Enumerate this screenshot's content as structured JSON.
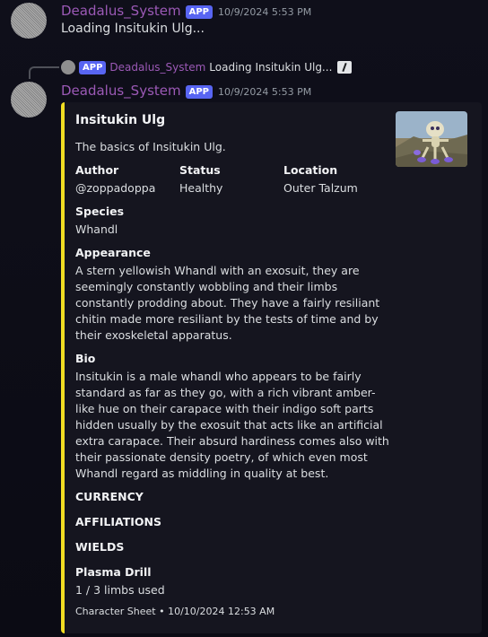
{
  "message1": {
    "username": "Deadalus_System",
    "badge": "APP",
    "timestamp": "10/9/2024 5:53 PM",
    "text": "Loading Insitukin Ulg..."
  },
  "reply": {
    "badge": "APP",
    "username": "Deadalus_System",
    "text": "Loading Insitukin Ulg..."
  },
  "message2": {
    "username": "Deadalus_System",
    "badge": "APP",
    "timestamp": "10/9/2024 5:53 PM"
  },
  "embed": {
    "accent_color": "#f1dd22",
    "title": "Insitukin Ulg",
    "description": "The basics of Insitukin Ulg.",
    "fields": {
      "author": {
        "name": "Author",
        "value": "@zoppadoppa"
      },
      "status": {
        "name": "Status",
        "value": "Healthy"
      },
      "location": {
        "name": "Location",
        "value": "Outer Talzum"
      },
      "species": {
        "name": "Species",
        "value": "Whandl"
      },
      "appearance": {
        "name": "Appearance",
        "value": "A stern yellowish Whandl with an exosuit, they are seemingly constantly wobbling and their limbs constantly prodding about. They have a fairly resiliant chitin made more resiliant by the tests of time and by their exoskeletal apparatus."
      },
      "bio": {
        "name": "Bio",
        "value": "Insitukin is a male whandl who appears to be fairly standard as far as they go, with a rich vibrant amber-like hue on their carapace with their indigo soft parts hidden usually by the exosuit that acts like an artificial extra carapace. Their absurd hardiness comes also with their passionate density poetry, of which even most Whandl regard as middling in quality at best."
      },
      "plasma_drill": {
        "name": "Plasma Drill",
        "value": "1 / 3 limbs used"
      }
    },
    "sections": {
      "currency": "CURRENCY",
      "affiliations": "AFFILIATIONS",
      "wields": "WIELDS"
    },
    "footer": "Character Sheet • 10/10/2024 12:53 AM"
  }
}
